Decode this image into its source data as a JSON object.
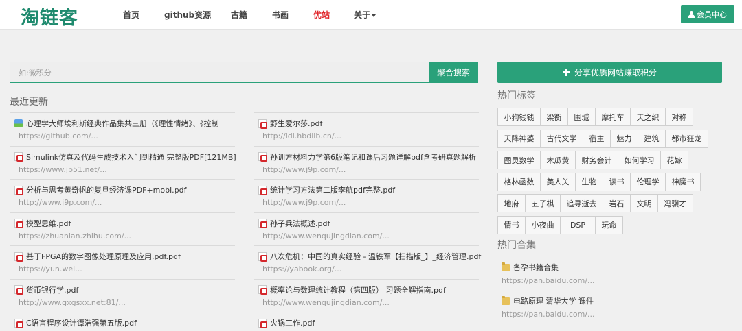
{
  "nav": {
    "logo": "淘链客",
    "items": [
      "首页",
      "github资源",
      "古籍",
      "书画",
      "优站",
      "关于"
    ],
    "member_label": "会员中心"
  },
  "search": {
    "placeholder": "如:微积分",
    "button_label": "聚合搜索"
  },
  "recent": {
    "title": "最近更新",
    "left": [
      {
        "title": "心理学大师埃利斯经典作品集共三册（《理性情绪》、《控制",
        "url": "https://github.com/...",
        "icon": "image-icon"
      },
      {
        "title": "Simulink仿真及代码生成技术入门到精通 完整版PDF[121MB]",
        "url": "https://www.jb51.net/...",
        "icon": "pdf-icon"
      },
      {
        "title": "分析与思考黄奇帆的复旦经济课PDF+mobi.pdf",
        "url": "http://www.j9p.com/...",
        "icon": "pdf-icon"
      },
      {
        "title": "模型思维.pdf",
        "url": "https://zhuanlan.zhihu.com/...",
        "icon": "pdf-icon"
      },
      {
        "title": "基于FPGA的数字图像处理原理及应用.pdf.pdf",
        "url": "https://yun.wei...",
        "icon": "pdf-icon"
      },
      {
        "title": "货币银行学.pdf",
        "url": "http://www.gxgsxx.net:81/...",
        "icon": "pdf-icon"
      },
      {
        "title": "C语言程序设计谭浩强第五版.pdf",
        "url": "",
        "icon": "pdf-icon"
      }
    ],
    "right": [
      {
        "title": "野生爱尔莎.pdf",
        "url": "http://idl.hbdlib.cn/...",
        "icon": "pdf-icon"
      },
      {
        "title": "孙训方材料力学第6版笔记和课后习题详解pdf含考研真题解析",
        "url": "http://www.j9p.com/...",
        "icon": "pdf-icon"
      },
      {
        "title": "统计学习方法第二版李航pdf完整.pdf",
        "url": "http://www.j9p.com/...",
        "icon": "pdf-icon"
      },
      {
        "title": "孙子兵法概述.pdf",
        "url": "http://www.wenqujingdian.com/...",
        "icon": "pdf-icon"
      },
      {
        "title": "八次危机：中国的真实经验 - 温铁军【扫描版_】_经济管理.pdf",
        "url": "https://yabook.org/...",
        "icon": "pdf-icon"
      },
      {
        "title": "概率论与数理统计教程（第四版） 习题全解指南.pdf",
        "url": "http://www.wenqujingdian.com/...",
        "icon": "pdf-icon"
      },
      {
        "title": "火锅工作.pdf",
        "url": "",
        "icon": "pdf-icon"
      }
    ]
  },
  "sidebar": {
    "share_label": "分享优质网站赚取积分",
    "tags_title": "热门标签",
    "tag_rows": [
      [
        "小狗钱钱",
        "梁衡",
        "围城",
        "摩托车",
        "天之织",
        "对称"
      ],
      [
        "天降神婆",
        "古代文学",
        "宿主",
        "魅力",
        "建筑",
        "都市狂龙"
      ],
      [
        "图灵数学",
        "木瓜黄",
        "财务会计",
        "如何学习",
        "花嫁"
      ],
      [
        "格林函数",
        "美人关",
        "生物",
        "读书",
        "伦理学",
        "神魔书"
      ],
      [
        "地府",
        "五子棋",
        "追寻逝去",
        "岩石",
        "文明",
        "冯骥才"
      ],
      [
        "情书",
        "小夜曲",
        "DSP",
        "玩命"
      ]
    ],
    "collections_title": "热门合集",
    "collections": [
      {
        "title": "备孕书籍合集",
        "url": "https://pan.baidu.com/..."
      },
      {
        "title": "电路原理 清华大学 课件",
        "url": "https://pan.baidu.com/..."
      }
    ]
  },
  "colors": {
    "accent": "#2aa17a",
    "logo": "#1f8a6e",
    "active_nav": "#e0262b"
  }
}
